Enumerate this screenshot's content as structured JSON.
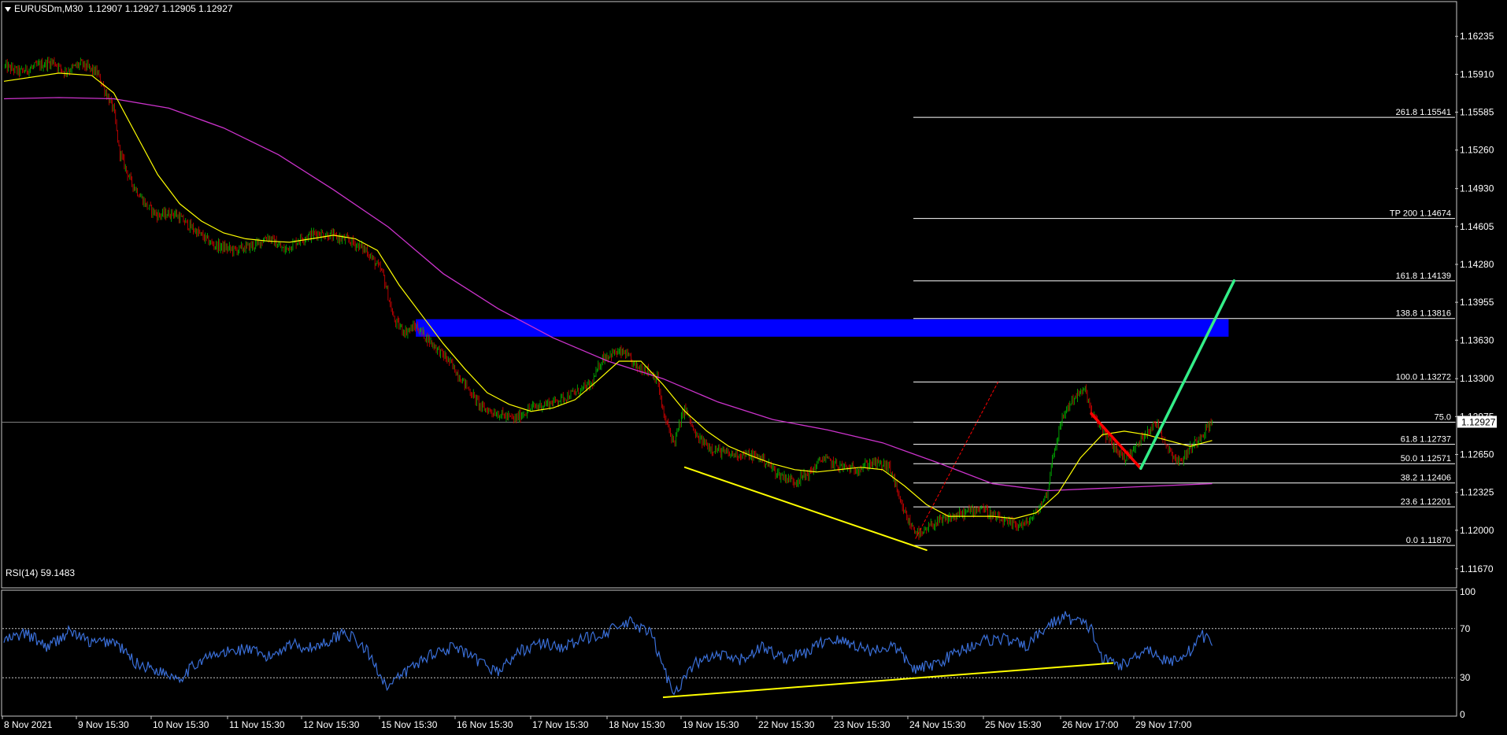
{
  "header": {
    "symbol": "EURUSDm,M30",
    "ohlc": "1.12907 1.12927 1.12905 1.12927"
  },
  "rsi_header": "RSI(14) 59.1483",
  "colors": {
    "background": "#000000",
    "grid_border": "#c8c8c8",
    "bull": "#00c000",
    "bear": "#e00000",
    "ma_fast": "#ffff00",
    "ma_slow": "#cc33cc",
    "zone": "#0000ff",
    "fib": "#ffffff",
    "trend_yellow": "#ffff00",
    "arrow_red": "#ff0000",
    "arrow_green": "#33ee88",
    "rsi_line": "#3a6fd8",
    "price_tag_bg": "#ffffff",
    "price_tag_fg": "#000000"
  },
  "chart_data": [
    {
      "type": "candlestick",
      "symbol": "EURUSDm",
      "timeframe": "M30",
      "y_ticks": [
        "1.16235",
        "1.15910",
        "1.15585",
        "1.15260",
        "1.14930",
        "1.14605",
        "1.14280",
        "1.13955",
        "1.13630",
        "1.13300",
        "1.12975",
        "1.12650",
        "1.12325",
        "1.12000",
        "1.11670"
      ],
      "ylim": [
        1.1152,
        1.1652
      ],
      "x_ticks": [
        "8 Nov 2021",
        "9 Nov 15:30",
        "10 Nov 15:30",
        "11 Nov 15:30",
        "12 Nov 15:30",
        "15 Nov 15:30",
        "16 Nov 15:30",
        "17 Nov 15:30",
        "18 Nov 15:30",
        "19 Nov 15:30",
        "22 Nov 15:30",
        "23 Nov 15:30",
        "24 Nov 15:30",
        "25 Nov 15:30",
        "26 Nov 17:00",
        "29 Nov 17:00"
      ],
      "current_price": "1.12927",
      "close_path": [
        [
          0,
          1.1598
        ],
        [
          0.015,
          1.1593
        ],
        [
          0.03,
          1.1598
        ],
        [
          0.045,
          1.1602
        ],
        [
          0.055,
          1.1593
        ],
        [
          0.07,
          1.16
        ],
        [
          0.085,
          1.1592
        ],
        [
          0.1,
          1.156
        ],
        [
          0.105,
          1.1525
        ],
        [
          0.115,
          1.15
        ],
        [
          0.13,
          1.1478
        ],
        [
          0.14,
          1.147
        ],
        [
          0.155,
          1.1472
        ],
        [
          0.17,
          1.146
        ],
        [
          0.19,
          1.1445
        ],
        [
          0.21,
          1.144
        ],
        [
          0.23,
          1.1445
        ],
        [
          0.24,
          1.1452
        ],
        [
          0.255,
          1.144
        ],
        [
          0.27,
          1.145
        ],
        [
          0.285,
          1.1455
        ],
        [
          0.3,
          1.1452
        ],
        [
          0.315,
          1.1448
        ],
        [
          0.33,
          1.144
        ],
        [
          0.345,
          1.142
        ],
        [
          0.355,
          1.138
        ],
        [
          0.365,
          1.137
        ],
        [
          0.375,
          1.1375
        ],
        [
          0.39,
          1.136
        ],
        [
          0.405,
          1.1345
        ],
        [
          0.42,
          1.1325
        ],
        [
          0.435,
          1.1305
        ],
        [
          0.45,
          1.13
        ],
        [
          0.465,
          1.1295
        ],
        [
          0.48,
          1.1305
        ],
        [
          0.5,
          1.131
        ],
        [
          0.52,
          1.1318
        ],
        [
          0.535,
          1.1325
        ],
        [
          0.545,
          1.1348
        ],
        [
          0.555,
          1.1352
        ],
        [
          0.565,
          1.1352
        ],
        [
          0.575,
          1.134
        ],
        [
          0.585,
          1.1338
        ],
        [
          0.595,
          1.133
        ],
        [
          0.6,
          1.13
        ],
        [
          0.61,
          1.1275
        ],
        [
          0.62,
          1.1305
        ],
        [
          0.63,
          1.128
        ],
        [
          0.645,
          1.127
        ],
        [
          0.66,
          1.1265
        ],
        [
          0.675,
          1.1265
        ],
        [
          0.69,
          1.1262
        ],
        [
          0.705,
          1.1248
        ],
        [
          0.72,
          1.1242
        ],
        [
          0.735,
          1.125
        ],
        [
          0.745,
          1.1262
        ],
        [
          0.76,
          1.1255
        ],
        [
          0.775,
          1.1252
        ],
        [
          0.79,
          1.1258
        ],
        [
          0.805,
          1.1255
        ],
        [
          0.81,
          1.1245
        ],
        [
          0.815,
          1.1225
        ],
        [
          0.825,
          1.1205
        ],
        [
          0.835,
          1.1195
        ],
        [
          0.845,
          1.1205
        ],
        [
          0.86,
          1.121
        ],
        [
          0.875,
          1.1215
        ],
        [
          0.89,
          1.122
        ],
        [
          0.9,
          1.1212
        ],
        [
          0.915,
          1.1205
        ],
        [
          0.93,
          1.1205
        ],
        [
          0.94,
          1.1215
        ],
        [
          0.95,
          1.1232
        ],
        [
          0.955,
          1.1265
        ],
        [
          0.965,
          1.13
        ],
        [
          0.975,
          1.1315
        ],
        [
          0.985,
          1.132
        ],
        [
          0.99,
          1.13
        ],
        [
          1.0,
          1.1286
        ],
        [
          1.01,
          1.1272
        ],
        [
          1.02,
          1.1262
        ],
        [
          1.03,
          1.127
        ],
        [
          1.04,
          1.1285
        ],
        [
          1.05,
          1.1292
        ],
        [
          1.06,
          1.127
        ],
        [
          1.07,
          1.1258
        ],
        [
          1.08,
          1.127
        ],
        [
          1.09,
          1.1282
        ],
        [
          1.1,
          1.1293
        ]
      ],
      "ma_fast_path": [
        [
          0,
          1.1585
        ],
        [
          0.05,
          1.1592
        ],
        [
          0.08,
          1.159
        ],
        [
          0.1,
          1.1575
        ],
        [
          0.12,
          1.154
        ],
        [
          0.14,
          1.1505
        ],
        [
          0.16,
          1.148
        ],
        [
          0.18,
          1.1465
        ],
        [
          0.2,
          1.1455
        ],
        [
          0.22,
          1.145
        ],
        [
          0.24,
          1.1448
        ],
        [
          0.26,
          1.1447
        ],
        [
          0.28,
          1.145
        ],
        [
          0.3,
          1.1453
        ],
        [
          0.32,
          1.145
        ],
        [
          0.34,
          1.144
        ],
        [
          0.36,
          1.141
        ],
        [
          0.38,
          1.1385
        ],
        [
          0.4,
          1.136
        ],
        [
          0.42,
          1.1338
        ],
        [
          0.44,
          1.1318
        ],
        [
          0.46,
          1.1308
        ],
        [
          0.48,
          1.1302
        ],
        [
          0.5,
          1.1305
        ],
        [
          0.52,
          1.1312
        ],
        [
          0.54,
          1.1328
        ],
        [
          0.56,
          1.1345
        ],
        [
          0.58,
          1.1345
        ],
        [
          0.6,
          1.1325
        ],
        [
          0.62,
          1.1302
        ],
        [
          0.64,
          1.1285
        ],
        [
          0.66,
          1.1272
        ],
        [
          0.68,
          1.1264
        ],
        [
          0.7,
          1.1257
        ],
        [
          0.72,
          1.1252
        ],
        [
          0.74,
          1.125
        ],
        [
          0.76,
          1.1252
        ],
        [
          0.78,
          1.1254
        ],
        [
          0.8,
          1.1252
        ],
        [
          0.82,
          1.1238
        ],
        [
          0.84,
          1.1222
        ],
        [
          0.86,
          1.1212
        ],
        [
          0.88,
          1.1212
        ],
        [
          0.9,
          1.1212
        ],
        [
          0.92,
          1.121
        ],
        [
          0.94,
          1.1215
        ],
        [
          0.96,
          1.1232
        ],
        [
          0.98,
          1.1262
        ],
        [
          1.0,
          1.1282
        ],
        [
          1.02,
          1.1285
        ],
        [
          1.04,
          1.1282
        ],
        [
          1.06,
          1.1277
        ],
        [
          1.08,
          1.1272
        ],
        [
          1.1,
          1.1277
        ]
      ],
      "ma_slow_path": [
        [
          0,
          1.157
        ],
        [
          0.05,
          1.1571
        ],
        [
          0.1,
          1.157
        ],
        [
          0.15,
          1.1562
        ],
        [
          0.2,
          1.1545
        ],
        [
          0.25,
          1.1522
        ],
        [
          0.3,
          1.1492
        ],
        [
          0.35,
          1.146
        ],
        [
          0.4,
          1.142
        ],
        [
          0.45,
          1.139
        ],
        [
          0.5,
          1.1365
        ],
        [
          0.55,
          1.1345
        ],
        [
          0.6,
          1.133
        ],
        [
          0.65,
          1.131
        ],
        [
          0.7,
          1.1295
        ],
        [
          0.75,
          1.1286
        ],
        [
          0.8,
          1.1275
        ],
        [
          0.85,
          1.1258
        ],
        [
          0.9,
          1.124
        ],
        [
          0.95,
          1.1234
        ],
        [
          1.0,
          1.1236
        ],
        [
          1.05,
          1.1238
        ],
        [
          1.1,
          1.124
        ]
      ],
      "fibonacci_levels": [
        {
          "label": "261.8 1.15541",
          "price": 1.15541
        },
        {
          "label": "TP 200 1.14674",
          "price": 1.14674
        },
        {
          "label": "161.8 1.14139",
          "price": 1.14139
        },
        {
          "label": "138.8 1.13816",
          "price": 1.13816
        },
        {
          "label": "100.0 1.13272",
          "price": 1.13272
        },
        {
          "label": "75.0",
          "price": 1.12927
        },
        {
          "label": "61.8 1.12737",
          "price": 1.12737
        },
        {
          "label": "50.0 1.12571",
          "price": 1.12571
        },
        {
          "label": "38.2 1.12406",
          "price": 1.12406
        },
        {
          "label": "23.6 1.12201",
          "price": 1.12201
        },
        {
          "label": "0.0 1.11870",
          "price": 1.1187
        }
      ],
      "resistance_zone": {
        "low": 1.1366,
        "high": 1.1381
      },
      "trendlines": [
        {
          "name": "falling-wedge-support",
          "from": [
            0.62,
            1.1254
          ],
          "to": [
            0.84,
            1.1183
          ]
        },
        {
          "name": "dotted-retrace",
          "from": [
            0.83,
            1.1193
          ],
          "to": [
            0.905,
            1.1327
          ]
        },
        {
          "name": "red-pullback-arrow",
          "from": [
            0.99,
            1.13
          ],
          "to": [
            1.035,
            1.1253
          ]
        },
        {
          "name": "green-projection-arrow",
          "from": [
            1.035,
            1.1253
          ],
          "to": [
            1.12,
            1.1414
          ]
        }
      ]
    },
    {
      "type": "line",
      "name": "RSI(14)",
      "value": "59.1483",
      "y_ticks": [
        "100",
        "70",
        "30",
        "0"
      ],
      "ylim": [
        0,
        100
      ],
      "levels": [
        70,
        30
      ],
      "rsi_path": [
        [
          0,
          60
        ],
        [
          0.02,
          66
        ],
        [
          0.04,
          55
        ],
        [
          0.06,
          68
        ],
        [
          0.08,
          58
        ],
        [
          0.1,
          60
        ],
        [
          0.12,
          42
        ],
        [
          0.14,
          36
        ],
        [
          0.16,
          30
        ],
        [
          0.18,
          45
        ],
        [
          0.2,
          50
        ],
        [
          0.22,
          54
        ],
        [
          0.24,
          46
        ],
        [
          0.26,
          58
        ],
        [
          0.28,
          54
        ],
        [
          0.3,
          62
        ],
        [
          0.31,
          68
        ],
        [
          0.33,
          52
        ],
        [
          0.35,
          22
        ],
        [
          0.37,
          38
        ],
        [
          0.39,
          50
        ],
        [
          0.41,
          55
        ],
        [
          0.43,
          44
        ],
        [
          0.45,
          35
        ],
        [
          0.47,
          52
        ],
        [
          0.49,
          58
        ],
        [
          0.51,
          55
        ],
        [
          0.53,
          62
        ],
        [
          0.55,
          68
        ],
        [
          0.57,
          75
        ],
        [
          0.59,
          65
        ],
        [
          0.6,
          38
        ],
        [
          0.61,
          18
        ],
        [
          0.63,
          42
        ],
        [
          0.65,
          48
        ],
        [
          0.67,
          44
        ],
        [
          0.69,
          55
        ],
        [
          0.71,
          46
        ],
        [
          0.73,
          50
        ],
        [
          0.75,
          62
        ],
        [
          0.77,
          58
        ],
        [
          0.79,
          52
        ],
        [
          0.81,
          56
        ],
        [
          0.83,
          36
        ],
        [
          0.85,
          42
        ],
        [
          0.87,
          52
        ],
        [
          0.89,
          60
        ],
        [
          0.91,
          62
        ],
        [
          0.93,
          55
        ],
        [
          0.95,
          72
        ],
        [
          0.965,
          80
        ],
        [
          0.98,
          75
        ],
        [
          0.99,
          70
        ],
        [
          1.0,
          45
        ],
        [
          1.02,
          40
        ],
        [
          1.04,
          55
        ],
        [
          1.05,
          48
        ],
        [
          1.06,
          42
        ],
        [
          1.08,
          52
        ],
        [
          1.09,
          65
        ],
        [
          1.1,
          59
        ]
      ],
      "divergence_line": {
        "from": [
          0.6,
          14
        ],
        "to": [
          1.01,
          42
        ]
      }
    }
  ]
}
